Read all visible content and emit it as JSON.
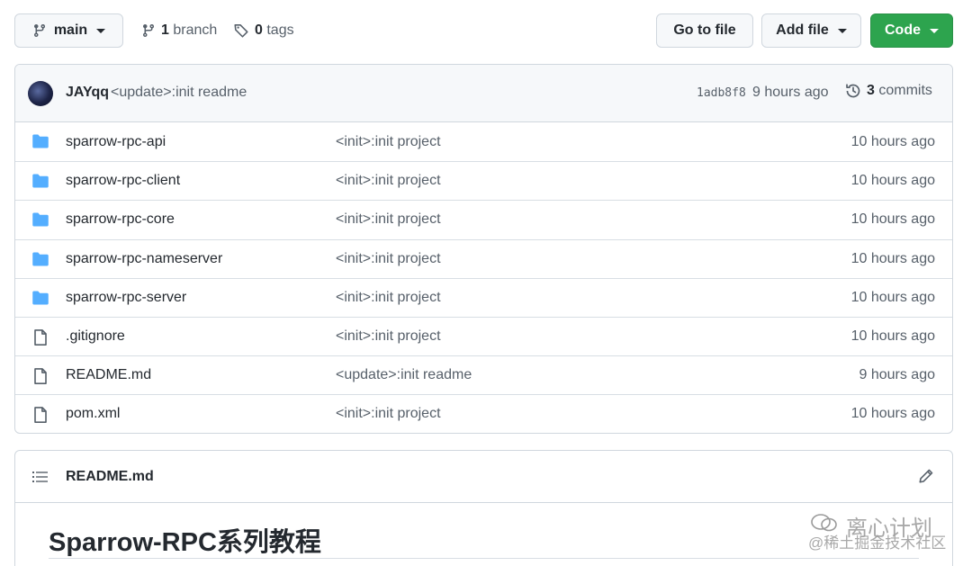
{
  "toolbar": {
    "branch_name": "main",
    "branches_count": "1",
    "branches_label": "branch",
    "tags_count": "0",
    "tags_label": "tags",
    "goto_label": "Go to file",
    "addfile_label": "Add file",
    "code_label": "Code"
  },
  "commit": {
    "author": "JAYqq",
    "message": "<update>:init readme",
    "sha": "1adb8f8",
    "time": "9 hours ago",
    "count": "3",
    "count_label": "commits"
  },
  "files": [
    {
      "type": "folder",
      "name": "sparrow-rpc-api",
      "message": "<init>:init project",
      "time": "10 hours ago"
    },
    {
      "type": "folder",
      "name": "sparrow-rpc-client",
      "message": "<init>:init project",
      "time": "10 hours ago"
    },
    {
      "type": "folder",
      "name": "sparrow-rpc-core",
      "message": "<init>:init project",
      "time": "10 hours ago"
    },
    {
      "type": "folder",
      "name": "sparrow-rpc-nameserver",
      "message": "<init>:init project",
      "time": "10 hours ago"
    },
    {
      "type": "folder",
      "name": "sparrow-rpc-server",
      "message": "<init>:init project",
      "time": "10 hours ago"
    },
    {
      "type": "file",
      "name": ".gitignore",
      "message": "<init>:init project",
      "time": "10 hours ago"
    },
    {
      "type": "file",
      "name": "README.md",
      "message": "<update>:init readme",
      "time": "9 hours ago"
    },
    {
      "type": "file",
      "name": "pom.xml",
      "message": "<init>:init project",
      "time": "10 hours ago"
    }
  ],
  "readme": {
    "title": "README.md",
    "heading": "Sparrow-RPC系列教程"
  },
  "watermark": {
    "line1": "离心计划",
    "line2": "@稀土掘金技术社区"
  },
  "colors": {
    "accent_green": "#2da44e",
    "folder_blue": "#54aeff",
    "muted_text": "#57606a"
  }
}
